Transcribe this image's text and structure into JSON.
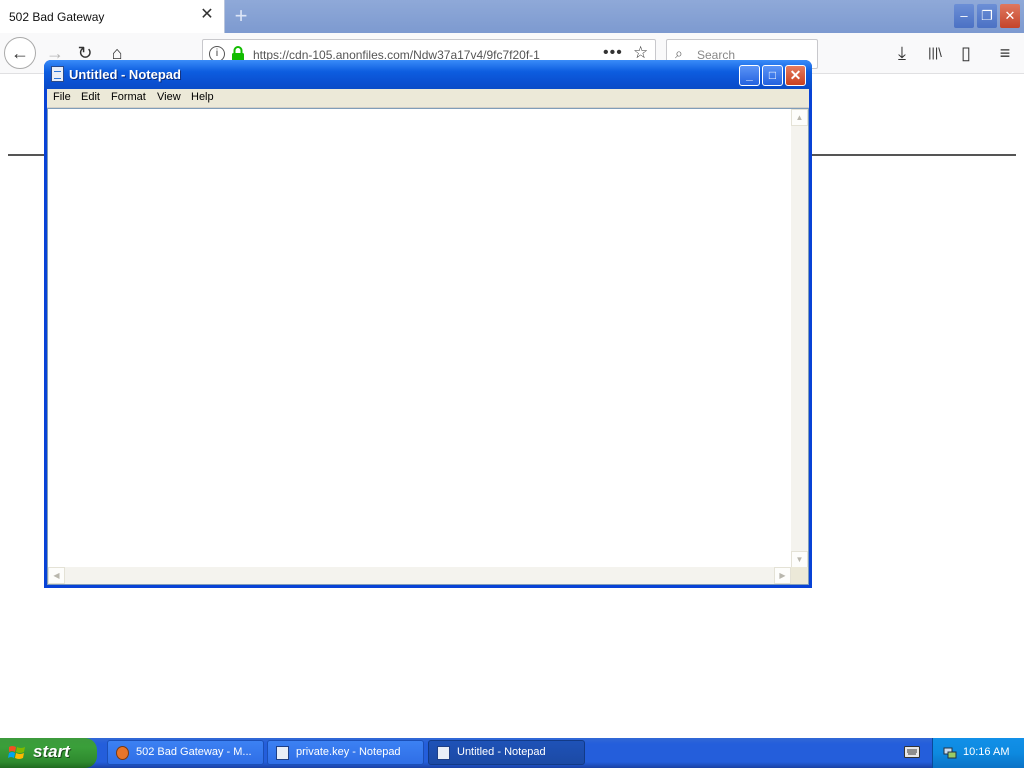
{
  "browser": {
    "tab_title": "502 Bad Gateway",
    "tab_close": "✕",
    "new_tab": "+",
    "window_controls": {
      "minimize": "–",
      "restore": "❐",
      "close": "✕"
    },
    "nav": {
      "back_icon": "←",
      "forward_icon": "→",
      "reload_icon": "↻",
      "home_icon": "⌂",
      "download_icon": "⤓",
      "library_icon": "|||\\",
      "sidebar_icon": "▯",
      "menu_icon": "≡"
    },
    "url": "https://cdn-105.anonfiles.com/Ndw37a17v4/9fc7f20f-1",
    "url_info": "i",
    "page_actions": "•••",
    "bookmark_icon": "☆",
    "search_placeholder": "Search",
    "search_icon": "⌕"
  },
  "notepad": {
    "title": "Untitled - Notepad",
    "menus": [
      "File",
      "Edit",
      "Format",
      "View",
      "Help"
    ],
    "buttons": {
      "minimize": "_",
      "maximize": "□",
      "close": "✕"
    },
    "content": ""
  },
  "taskbar": {
    "start_label": "start",
    "tasks": [
      {
        "label": "502 Bad Gateway - M...",
        "active": false
      },
      {
        "label": "private.key - Notepad",
        "active": false
      },
      {
        "label": "Untitled - Notepad",
        "active": true
      }
    ],
    "clock": "10:16 AM"
  },
  "colors": {
    "xp_title_blue": "#0a4fd0",
    "xp_start_green": "#3a9f3a",
    "taskbar_blue": "#245edb",
    "tray_blue": "#0d8ae0",
    "secure_lock": "#12bc00"
  }
}
